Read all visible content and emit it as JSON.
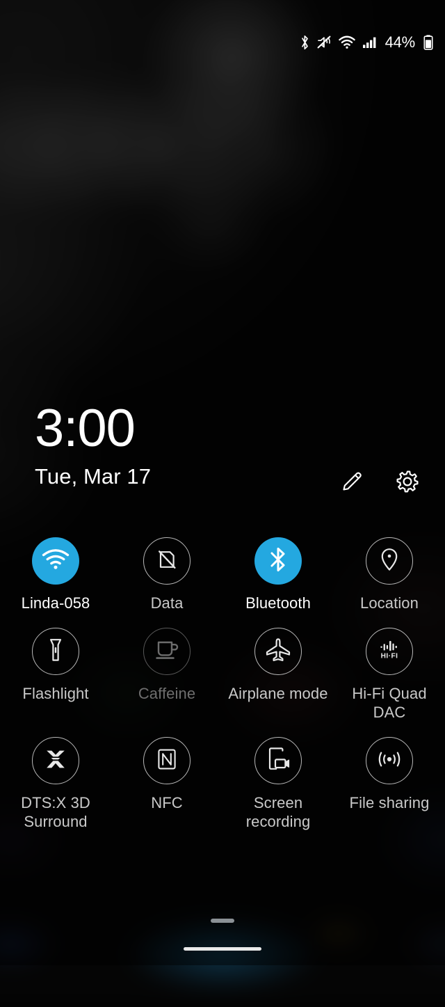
{
  "status_bar": {
    "icons": [
      "bluetooth-icon",
      "sound-mute-icon",
      "wifi-icon",
      "cellular-signal-icon"
    ],
    "battery_percent": "44%",
    "battery_icon": "battery-icon"
  },
  "clock": {
    "time": "3:00",
    "date": "Tue, Mar 17"
  },
  "panel_actions": [
    {
      "name": "edit-button",
      "icon": "pencil-icon"
    },
    {
      "name": "settings-button",
      "icon": "gear-icon"
    }
  ],
  "quick_settings": {
    "tiles": [
      {
        "label": "Linda-058",
        "icon": "wifi-icon",
        "state": "on"
      },
      {
        "label": "Data",
        "icon": "mobile-data-off-icon",
        "state": "off"
      },
      {
        "label": "Bluetooth",
        "icon": "bluetooth-icon",
        "state": "on"
      },
      {
        "label": "Location",
        "icon": "location-pin-icon",
        "state": "off"
      },
      {
        "label": "Flashlight",
        "icon": "flashlight-icon",
        "state": "off"
      },
      {
        "label": "Caffeine",
        "icon": "coffee-cup-icon",
        "state": "dim"
      },
      {
        "label": "Airplane mode",
        "icon": "airplane-icon",
        "state": "off"
      },
      {
        "label": "Hi-Fi Quad DAC",
        "icon": "hifi-dac-icon",
        "state": "off"
      },
      {
        "label": "DTS:X 3D Surround",
        "icon": "dtsx-icon",
        "state": "off"
      },
      {
        "label": "NFC",
        "icon": "nfc-icon",
        "state": "off"
      },
      {
        "label": "Screen recording",
        "icon": "screen-recording-icon",
        "state": "off"
      },
      {
        "label": "File sharing",
        "icon": "file-sharing-icon",
        "state": "off"
      }
    ]
  },
  "bottom": {
    "drag_handle": "drag-handle",
    "home_indicator": "home-indicator"
  },
  "colors": {
    "accent": "#24a8e0",
    "background": "#000000",
    "text": "#ffffff",
    "text_dim": "#6e6e6e"
  }
}
